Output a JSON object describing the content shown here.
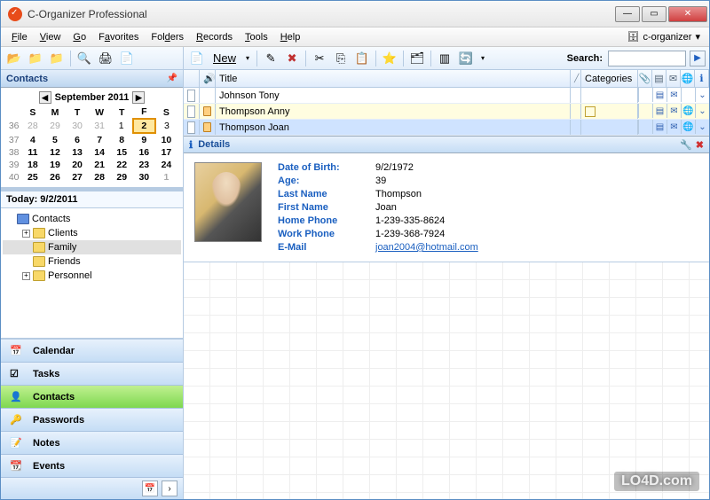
{
  "window": {
    "title": "C-Organizer Professional"
  },
  "menu": {
    "items": [
      "File",
      "View",
      "Go",
      "Favorites",
      "Folders",
      "Records",
      "Tools",
      "Help"
    ],
    "database": "c-organizer"
  },
  "sidebar": {
    "header": "Contacts",
    "calendar": {
      "month_label": "September 2011",
      "days": [
        "S",
        "M",
        "T",
        "W",
        "T",
        "F",
        "S"
      ],
      "weeks": [
        {
          "wk": "36",
          "cells": [
            {
              "d": "28",
              "o": true
            },
            {
              "d": "29",
              "o": true
            },
            {
              "d": "30",
              "o": true
            },
            {
              "d": "31",
              "o": true
            },
            {
              "d": "1"
            },
            {
              "d": "2",
              "today": true
            },
            {
              "d": "3"
            }
          ]
        },
        {
          "wk": "37",
          "cells": [
            {
              "d": "4"
            },
            {
              "d": "5"
            },
            {
              "d": "6"
            },
            {
              "d": "7"
            },
            {
              "d": "8"
            },
            {
              "d": "9"
            },
            {
              "d": "10"
            }
          ]
        },
        {
          "wk": "38",
          "cells": [
            {
              "d": "11"
            },
            {
              "d": "12"
            },
            {
              "d": "13"
            },
            {
              "d": "14"
            },
            {
              "d": "15"
            },
            {
              "d": "16"
            },
            {
              "d": "17"
            }
          ]
        },
        {
          "wk": "39",
          "cells": [
            {
              "d": "18"
            },
            {
              "d": "19"
            },
            {
              "d": "20"
            },
            {
              "d": "21"
            },
            {
              "d": "22"
            },
            {
              "d": "23"
            },
            {
              "d": "24"
            }
          ]
        },
        {
          "wk": "40",
          "cells": [
            {
              "d": "25"
            },
            {
              "d": "26"
            },
            {
              "d": "27"
            },
            {
              "d": "28"
            },
            {
              "d": "29"
            },
            {
              "d": "30"
            },
            {
              "d": "1",
              "o": true
            }
          ]
        }
      ]
    },
    "today_label": "Today: 9/2/2011",
    "tree": {
      "root": "Contacts",
      "children": [
        {
          "label": "Clients",
          "expandable": true
        },
        {
          "label": "Family",
          "expandable": false,
          "selected": true
        },
        {
          "label": "Friends",
          "expandable": false
        },
        {
          "label": "Personnel",
          "expandable": true
        }
      ]
    },
    "nav": [
      {
        "label": "Calendar",
        "icon": "calendar-icon"
      },
      {
        "label": "Tasks",
        "icon": "tasks-icon"
      },
      {
        "label": "Contacts",
        "icon": "contacts-icon",
        "active": true
      },
      {
        "label": "Passwords",
        "icon": "passwords-icon"
      },
      {
        "label": "Notes",
        "icon": "notes-icon"
      },
      {
        "label": "Events",
        "icon": "events-icon"
      }
    ]
  },
  "toolbar": {
    "new_label": "New",
    "search_label": "Search:"
  },
  "grid": {
    "columns": {
      "title": "Title",
      "categories": "Categories"
    },
    "rows": [
      {
        "title": "Johnson Tony",
        "card": false,
        "cat": false,
        "sel": false
      },
      {
        "title": "Thompson Anny",
        "card": true,
        "cat": true,
        "sel": false,
        "alt": true
      },
      {
        "title": "Thompson Joan",
        "card": true,
        "cat": false,
        "sel": true
      }
    ]
  },
  "details": {
    "header": "Details",
    "fields": [
      {
        "label": "Date of Birth:",
        "value": "9/2/1972"
      },
      {
        "label": "Age:",
        "value": "39"
      },
      {
        "label": "Last Name",
        "value": "Thompson"
      },
      {
        "label": "First Name",
        "value": "Joan"
      },
      {
        "label": "Home Phone",
        "value": "1-239-335-8624"
      },
      {
        "label": "Work Phone",
        "value": "1-239-368-7924"
      },
      {
        "label": "E-Mail",
        "value": "joan2004@hotmail.com",
        "link": true
      }
    ]
  },
  "watermark": "LO4D.com"
}
